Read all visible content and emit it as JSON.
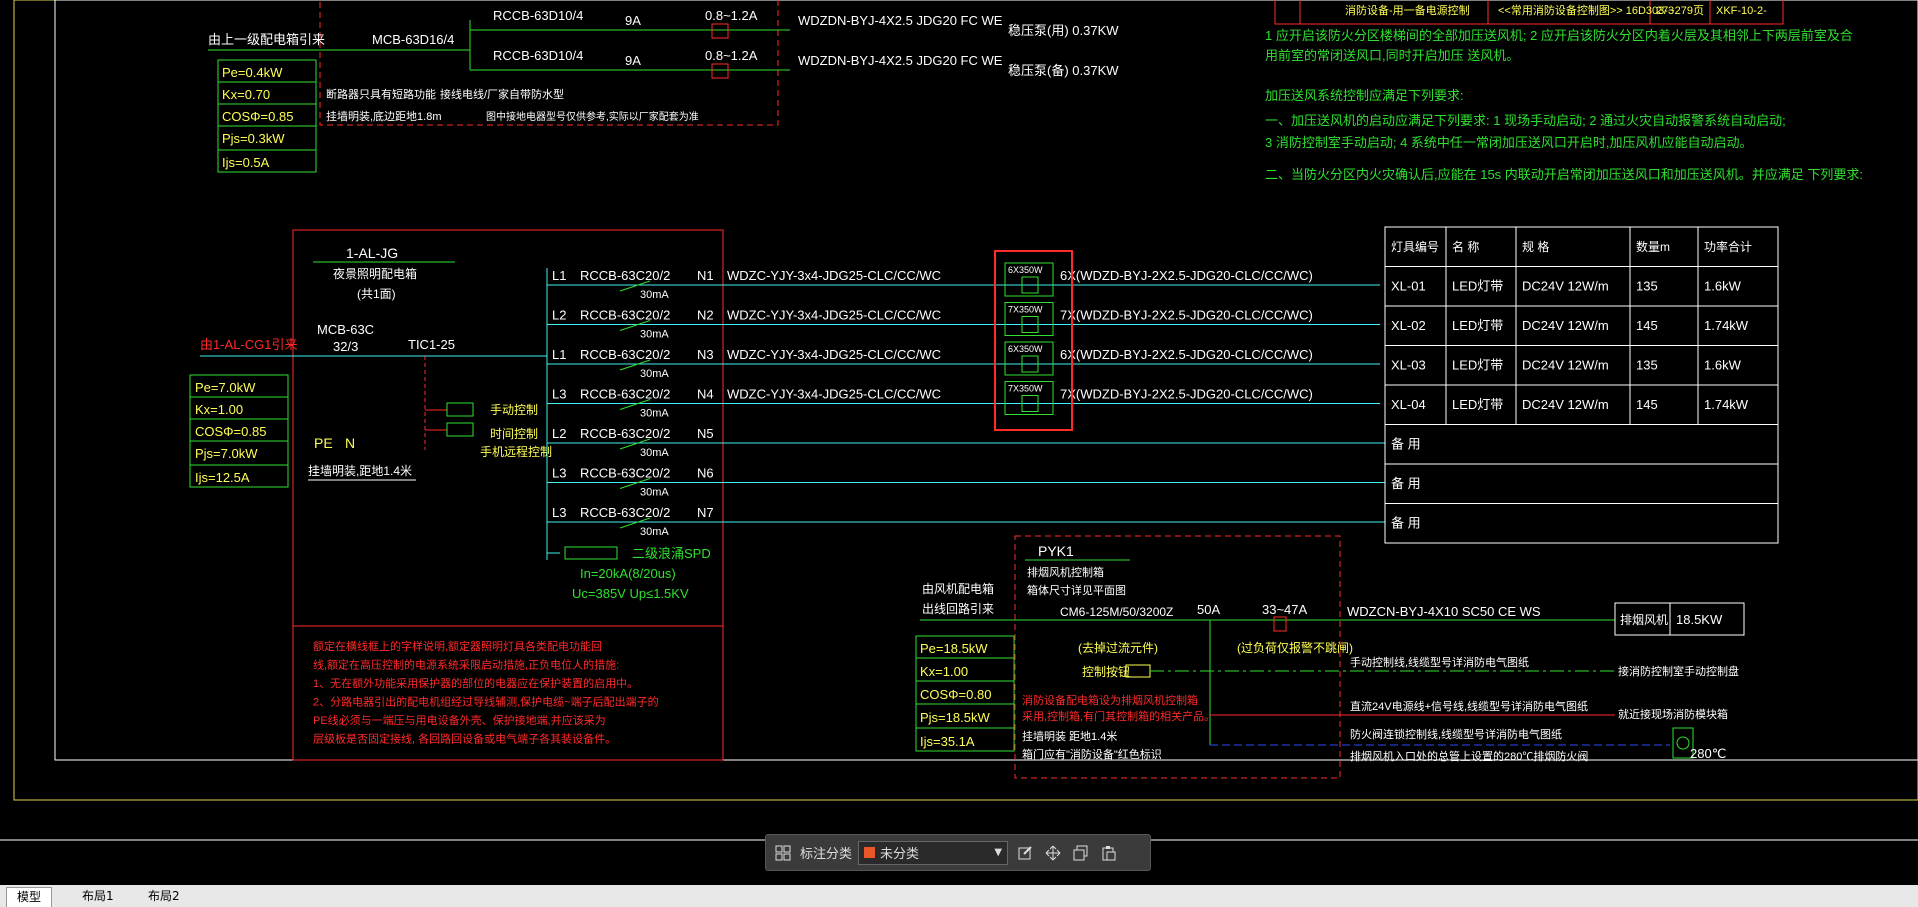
{
  "colors": {
    "bg": "#000000",
    "red": "#ff2a2a",
    "green": "#2fe02f",
    "yellow": "#ffff55",
    "cyan": "#3ff0f0",
    "white": "#ffffff",
    "blue": "#2a4bff"
  },
  "top": {
    "source": "由上一级配电箱引来",
    "mcb": "MCB-63D16/4",
    "rccb1": "RCCB-63D10/4",
    "rccb2": "RCCB-63D10/4",
    "amp1": "9A",
    "amp2": "9A",
    "range1": "0.8~1.2A",
    "range2": "0.8~1.2A",
    "cable1": "WDZDN-BYJ-4X2.5 JDG20 FC WE",
    "cable2": "WDZDN-BYJ-4X2.5 JDG20 FC WE",
    "load1": "稳压泵(用) 0.37KW",
    "load2": "稳压泵(备) 0.37KW",
    "note1": "断路器只具有短路功能",
    "note2": "接线电线/厂家自带防水型",
    "note3": "挂墙明装,底边距地1.8m",
    "note4": "图中接地电器型号仅供参考,实际以厂家配套为准",
    "params": [
      "Pe=0.4kW",
      "Kx=0.70",
      "COSΦ=0.85",
      "Pjs=0.3kW",
      "Ijs=0.5A"
    ]
  },
  "notes_right": {
    "l1": "1 应开启该防火分区楼梯间的全部加压送风机; 2 应开启该防火分区内着火层及其相邻上下两层前室及合",
    "l2": "用前室的常闭送风口,同时开启加压 送风机。",
    "l3": "加压送风系统控制应满足下列要求:",
    "l4": "一、加压送风机的启动应满足下列要求: 1 现场手动启动; 2 通过火灾自动报警系统自动启动;",
    "l5": "3 消防控制室手动启动; 4 系统中任一常闭加压送风口开启时,加压风机应能自动启动。",
    "l6": "二、当防火分区内火灾确认后,应能在 15s 内联动开启常闭加压送风口和加压送风机。并应满足 下列要求:"
  },
  "top_table": {
    "c1": "消防设备-用一备电源控制",
    "c2": "<<常用消防设备控制图>> 16D303-3",
    "c3": "27~279页",
    "c4": "XKF-10-2-"
  },
  "panel": {
    "name": "1-AL-JG",
    "desc": "夜景照明配电箱",
    "count": "(共1面)",
    "source": "由1-AL-CG1引来",
    "mcb": "MCB-63C",
    "mcb_spec": "32/3",
    "contactor": "TIC1-25",
    "manual": "手动控制",
    "timer": "时间控制",
    "remote": "手机远程控制",
    "pe_n": "PE",
    "n": "N",
    "install": "挂墙明装,距地1.4米",
    "spd": "二级浪涌SPD",
    "spd_in": "In=20kA(8/20us)",
    "spd_uc": "Uc=385V Up≤1.5KV",
    "params": [
      "Pe=7.0kW",
      "Kx=1.00",
      "COSΦ=0.85",
      "Pjs=7.0kW",
      "Ijs=12.5A"
    ],
    "circuits": [
      {
        "phase": "L1",
        "breaker": "RCCB-63C20/2",
        "ma": "30mA",
        "n": "N1",
        "cable": "WDZC-YJY-3x4-JDG25-CLC/CC/WC",
        "fix": "6X350W",
        "branch": "6X(WDZD-BYJ-2X2.5-JDG20-CLC/CC/WC)"
      },
      {
        "phase": "L2",
        "breaker": "RCCB-63C20/2",
        "ma": "30mA",
        "n": "N2",
        "cable": "WDZC-YJY-3x4-JDG25-CLC/CC/WC",
        "fix": "7X350W",
        "branch": "7X(WDZD-BYJ-2X2.5-JDG20-CLC/CC/WC)"
      },
      {
        "phase": "L1",
        "breaker": "RCCB-63C20/2",
        "ma": "30mA",
        "n": "N3",
        "cable": "WDZC-YJY-3x4-JDG25-CLC/CC/WC",
        "fix": "6X350W",
        "branch": "6X(WDZD-BYJ-2X2.5-JDG20-CLC/CC/WC)"
      },
      {
        "phase": "L3",
        "breaker": "RCCB-63C20/2",
        "ma": "30mA",
        "n": "N4",
        "cable": "WDZC-YJY-3x4-JDG25-CLC/CC/WC",
        "fix": "7X350W",
        "branch": "7X(WDZD-BYJ-2X2.5-JDG20-CLC/CC/WC)"
      },
      {
        "phase": "L2",
        "breaker": "RCCB-63C20/2",
        "ma": "30mA",
        "n": "N5",
        "cable": "",
        "fix": "",
        "branch": ""
      },
      {
        "phase": "L3",
        "breaker": "RCCB-63C20/2",
        "ma": "30mA",
        "n": "N6",
        "cable": "",
        "fix": "",
        "branch": ""
      },
      {
        "phase": "L3",
        "breaker": "RCCB-63C20/2",
        "ma": "30mA",
        "n": "N7",
        "cable": "",
        "fix": "",
        "branch": ""
      }
    ],
    "red_notes": [
      "额定在横线框上的字样说明,额定器照明灯具各类配电功能回",
      "线,额定在高压控制的电源系统采限启动措施,正负电位人的措施:",
      "1、无在额外功能采用保护器的部位的电器应在保护装置的启用中。",
      "2、分路电器引出的配电机组经过导线辅测,保护电缆~端子后配出端子的",
      "PE线必须与一端压与用电设备外壳、保护接地端,并应该采为",
      "层级板是否固定接线, 各回路回设备或电气端子各其装设备件。"
    ]
  },
  "lamp_table": {
    "headers": [
      "灯具编号",
      "名 称",
      "规 格",
      "数量m",
      "功率合计"
    ],
    "rows": [
      [
        "XL-01",
        "LED灯带",
        "DC24V 12W/m",
        "135",
        "1.6kW"
      ],
      [
        "XL-02",
        "LED灯带",
        "DC24V 12W/m",
        "145",
        "1.74kW"
      ],
      [
        "XL-03",
        "LED灯带",
        "DC24V 12W/m",
        "135",
        "1.6kW"
      ],
      [
        "XL-04",
        "LED灯带",
        "DC24V 12W/m",
        "145",
        "1.74kW"
      ],
      [
        "备 用"
      ],
      [
        "备 用"
      ],
      [
        "备 用"
      ]
    ]
  },
  "pyk": {
    "name": "PYK1",
    "desc1": "排烟风机控制箱",
    "desc2": "箱体尺寸详见平面图",
    "source1": "由风机配电箱",
    "source2": "出线回路引来",
    "breaker": "CM6-125M/50/3200Z",
    "amp": "50A",
    "range": "33~47A",
    "cable": "WDZCN-BYJ-4X10 SC50 CE WS",
    "load": "排烟风机",
    "load_kw": "18.5KW",
    "note_prot1": "(去掉过流元件)",
    "note_prot2": "控制按钮",
    "note_over": "(过负荷仅报警不跳闸)",
    "ctrl1": "手动控制线,线缆型号详消防电气图纸",
    "ctrl1_to": "接消防控制室手动控制盘",
    "ctrl2": "直流24V电源线+信号线,线缆型号详消防电气图纸",
    "ctrl2_to": "就近接现场消防模块箱",
    "ctrl3": "防火阀连锁控制线,线缆型号详消防电气图纸",
    "ctrl4": "排烟风机入口处的总管上设置的280℃排烟防火阀",
    "temp": "280℃",
    "red1": "消防设备配电箱设为排烟风机控制箱",
    "red2": "采用,控制箱,有门其控制箱的相关产品。",
    "install1": "挂墙明装 距地1.4米",
    "install2": "箱门应有\"消防设备\"红色标识",
    "params": [
      "Pe=18.5kW",
      "Kx=1.00",
      "COSΦ=0.80",
      "Pjs=18.5kW",
      "Ijs=35.1A"
    ]
  },
  "toolbar": {
    "label": "标注分类",
    "selected": "未分类"
  },
  "tabs": [
    "模型",
    "布局1",
    "布局2"
  ]
}
